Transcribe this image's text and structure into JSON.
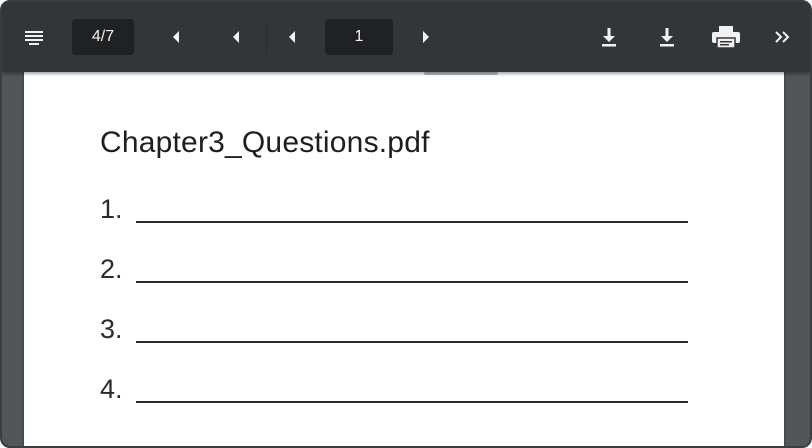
{
  "toolbar": {
    "menu_icon": "hamburger-menu-icon",
    "page_indicator": "4/7",
    "page_input_value": "1",
    "icons": {
      "prev_1": "chevron-left-icon",
      "prev_2": "chevron-left-icon",
      "prev_3": "chevron-left-icon",
      "next": "chevron-right-icon",
      "download_1": "download-icon",
      "download_2": "download-icon",
      "print": "printer-icon",
      "more": "double-chevron-right-icon"
    }
  },
  "document": {
    "title": "Chapter3_Questions.pdf",
    "questions": [
      {
        "number": "1."
      },
      {
        "number": "2."
      },
      {
        "number": "3."
      },
      {
        "number": "4."
      }
    ]
  },
  "colors": {
    "toolbar_bg": "#323639",
    "toolbar_box_bg": "#1f2123",
    "viewer_bg": "#525659",
    "page_bg": "#ffffff",
    "text": "#1e1e1e"
  }
}
